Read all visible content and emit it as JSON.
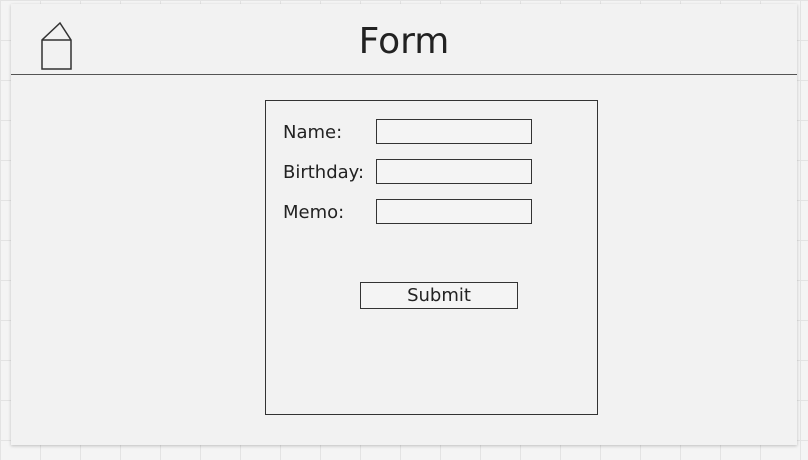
{
  "header": {
    "title": "Form",
    "home_icon": "home-icon"
  },
  "form": {
    "fields": [
      {
        "label": "Name:",
        "value": "",
        "placeholder": ""
      },
      {
        "label": "Birthday:",
        "value": "",
        "placeholder": ""
      },
      {
        "label": "Memo:",
        "value": "",
        "placeholder": ""
      }
    ],
    "submit_label": "Submit"
  },
  "colors": {
    "background": "#f2f2f2",
    "stroke": "#333333",
    "grid": "#e3e3e3"
  }
}
